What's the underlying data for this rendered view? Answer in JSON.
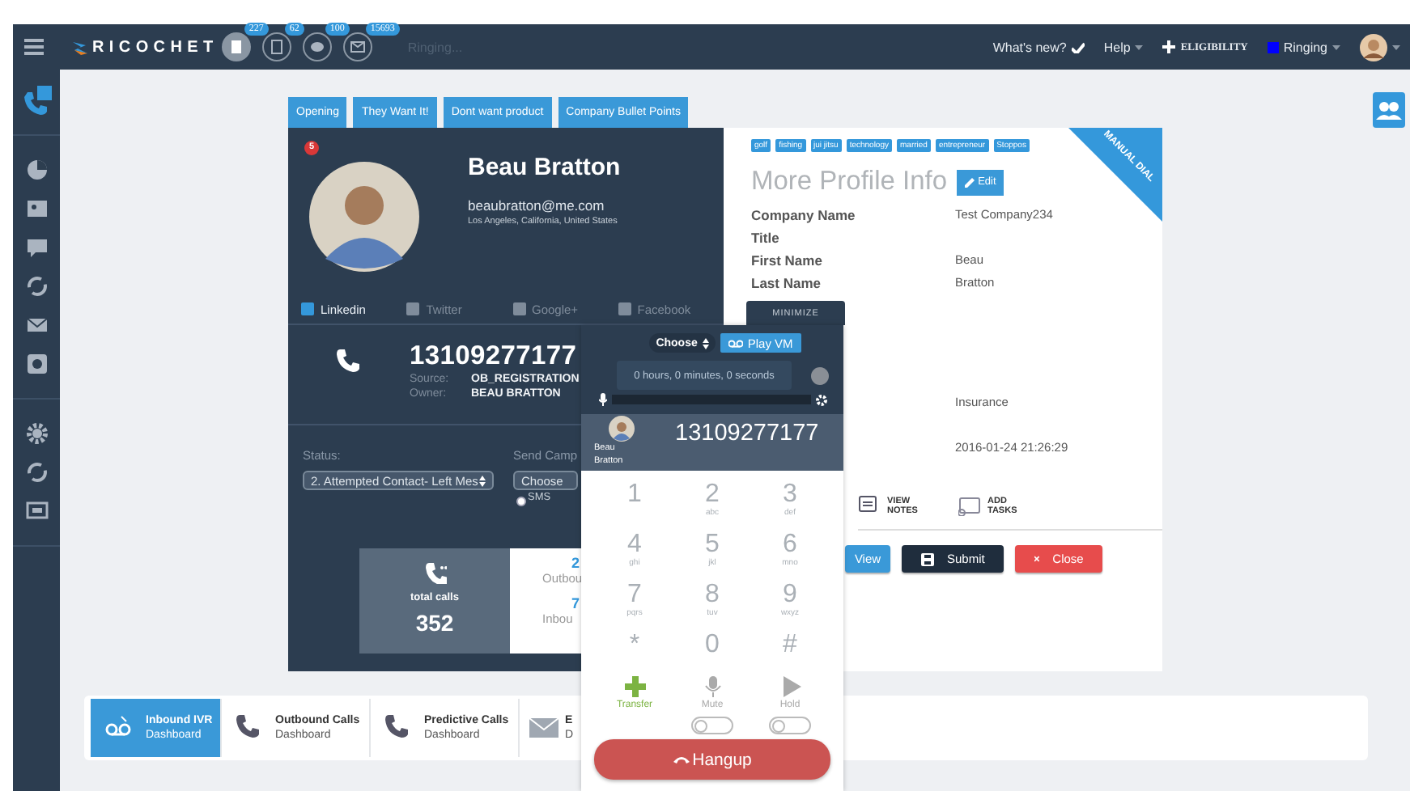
{
  "header": {
    "logo": "RICOCHET",
    "counters": [
      {
        "count": "227",
        "active": true
      },
      {
        "count": "62",
        "active": false
      },
      {
        "count": "100",
        "active": false
      },
      {
        "count": "15693",
        "active": false
      }
    ],
    "call_state": "Ringing...",
    "links": [
      {
        "label": "What's new?",
        "kind": "check"
      },
      {
        "label": "Help",
        "kind": "dropdown"
      },
      {
        "label": "ELIGIBILITY",
        "kind": "plus"
      },
      {
        "label": "Ringing",
        "kind": "status"
      }
    ]
  },
  "sidebar": {
    "items": [
      {
        "selected": true
      },
      {
        "selected": false
      },
      {
        "selected": false
      },
      {
        "selected": false
      },
      {
        "selected": false
      },
      {
        "selected": false
      },
      {
        "selected": false
      },
      {
        "selected": false
      },
      {
        "selected": false
      },
      {
        "selected": false
      }
    ]
  },
  "script_tabs": [
    {
      "label": "Opening"
    },
    {
      "label": "They Want It!"
    },
    {
      "label": "Dont want product"
    },
    {
      "label": "Company Bullet Points"
    }
  ],
  "contact": {
    "notifications": "5",
    "name": "Beau Bratton",
    "email": "beaubratton@me.com",
    "location": "Los Angeles, California, United States",
    "social": [
      {
        "label": "Linkedin",
        "selected": true
      },
      {
        "label": "Twitter",
        "selected": false
      },
      {
        "label": "Google+",
        "selected": false
      },
      {
        "label": "Facebook",
        "selected": false
      }
    ],
    "phone": {
      "number": "13109277177",
      "source_label": "Source:",
      "source": "OB_REGISTRATION",
      "owner_label": "Owner:",
      "owner": "BEAU BRATTON"
    },
    "status": {
      "label": "Status:",
      "value": "2. Attempted Contact- Left Mes"
    },
    "campaign": {
      "label": "Send Camp",
      "value": "Choose",
      "options": [
        {
          "label": "SMS",
          "checked": false
        }
      ]
    },
    "stats": {
      "total_label": "total calls",
      "total": "352",
      "outbound_value": "2",
      "outbound_label": "Outbou",
      "inbound_value": "7",
      "inbound_label": "Inbou"
    }
  },
  "profile": {
    "ribbon": "MANUAL DIAL",
    "tags": [
      "golf",
      "fishing",
      "jui jitsu",
      "technology",
      "married",
      "entrepreneur",
      "Stoppos"
    ],
    "title": "More Profile Info",
    "edit": "Edit",
    "fields": [
      {
        "label": "Company Name",
        "value": "Test Company234"
      },
      {
        "label": "Title"
      },
      {
        "label": "First Name",
        "value": "Beau"
      },
      {
        "label": "Last Name",
        "value": "Bratton"
      }
    ],
    "more_values": [
      "Insurance",
      "2016-01-24 21:26:29"
    ],
    "actions": [
      {
        "label": "VIEW NOTES"
      },
      {
        "label": "ADD TASKS"
      }
    ],
    "buttons": [
      {
        "label": "View",
        "kind": "primary"
      },
      {
        "label": "Submit",
        "kind": "dark"
      },
      {
        "label": "Close",
        "kind": "danger"
      }
    ]
  },
  "dialer": {
    "minimize": "MINIMIZE",
    "vm_select": "Choose",
    "play_vm": "Play VM",
    "timer": "0 hours, 0 minutes, 0 seconds",
    "caller": "Beau Bratton",
    "number": "13109277177",
    "keys": [
      {
        "digit": "1"
      },
      {
        "digit": "2",
        "letters": "abc"
      },
      {
        "digit": "3",
        "letters": "def"
      },
      {
        "digit": "4",
        "letters": "ghi"
      },
      {
        "digit": "5",
        "letters": "jkl"
      },
      {
        "digit": "6",
        "letters": "mno"
      },
      {
        "digit": "7",
        "letters": "pqrs"
      },
      {
        "digit": "8",
        "letters": "tuv"
      },
      {
        "digit": "9",
        "letters": "wxyz"
      },
      {
        "digit": "*"
      },
      {
        "digit": "0"
      },
      {
        "digit": "#"
      }
    ],
    "actions": [
      {
        "label": "Transfer",
        "kind": "transfer"
      },
      {
        "label": "Mute",
        "kind": "mute",
        "on": false
      },
      {
        "label": "Hold",
        "kind": "hold",
        "on": false
      }
    ],
    "hangup": "Hangup"
  },
  "dashboards": [
    {
      "title": "Inbound IVR",
      "subtitle": "Dashboard",
      "selected": true
    },
    {
      "title": "Outbound Calls",
      "subtitle": "Dashboard",
      "selected": false
    },
    {
      "title": "Predictive Calls",
      "subtitle": "Dashboard",
      "selected": false
    },
    {
      "title": "E",
      "subtitle": "D",
      "selected": false
    }
  ]
}
